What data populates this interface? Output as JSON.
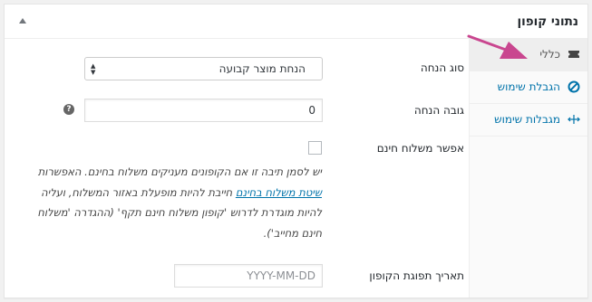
{
  "header": {
    "title": "נתוני קופון"
  },
  "tabs": [
    {
      "label": "כללי",
      "icon": "ticket-icon",
      "active": true
    },
    {
      "label": "הגבלת שימוש",
      "icon": "no-entry-icon",
      "active": false
    },
    {
      "label": "מגבלות שימוש",
      "icon": "arrows-horizontal-icon",
      "active": false
    }
  ],
  "general": {
    "discount_type_label": "סוג הנחה",
    "discount_type_value": "הנחת מוצר קבועה",
    "amount_label": "גובה הנחה",
    "amount_value": "0",
    "help_icon": "?",
    "free_shipping_label": "אפשר משלוח חינם",
    "free_shipping_checked": false,
    "free_shipping_desc_before": "יש לסמן תיבה זו אם הקופונים מעניקים משלוח בחינם. האפשרות ",
    "free_shipping_desc_link": "שיטת משלוח בחינם",
    "free_shipping_desc_after": " חייבת להיות מופעלת באזור המשלוח, ועליה להיות מוגדרת לדרוש 'קופון משלוח חינם תקף' (ההגדרה 'משלוח חינם מחייב').",
    "expiry_label": "תאריך תפוגת הקופון",
    "expiry_placeholder": "YYYY-MM-DD"
  },
  "colors": {
    "accent": "#0073aa",
    "annotation_arrow": "#c9468f"
  }
}
